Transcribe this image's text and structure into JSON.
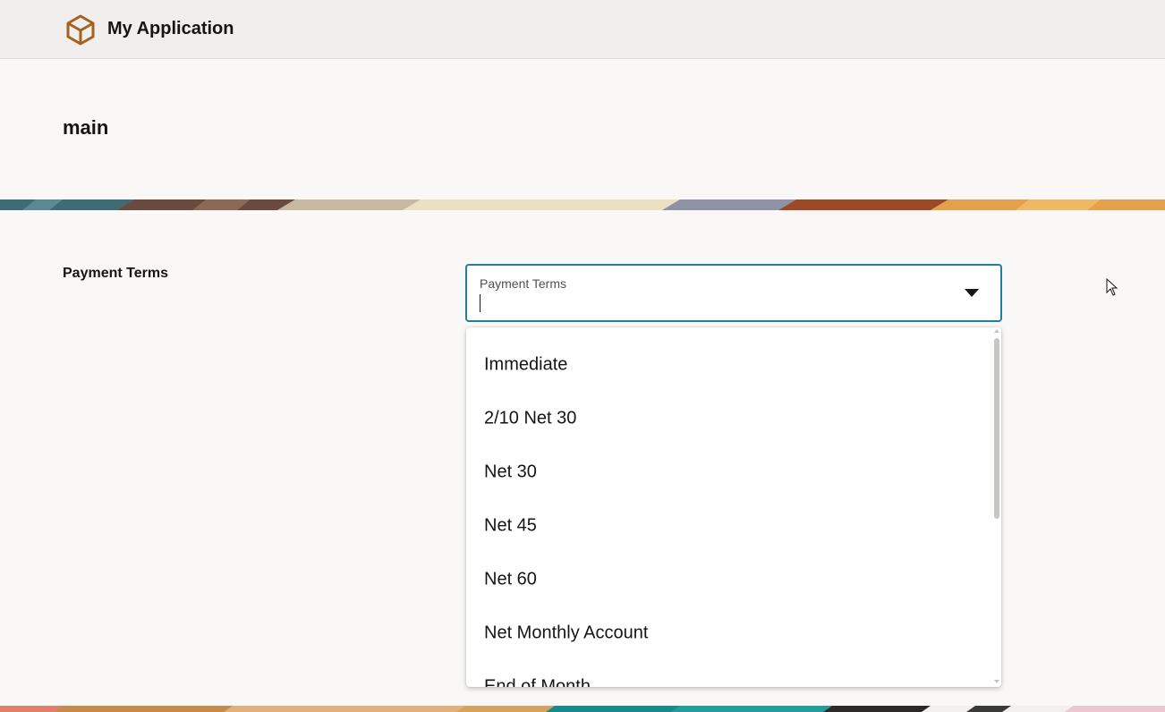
{
  "header": {
    "app_title": "My Application",
    "logo_icon": "package-box-icon",
    "logo_color": "#a6611e"
  },
  "page": {
    "title": "main"
  },
  "form": {
    "field_label": "Payment Terms",
    "combobox": {
      "floating_label": "Payment Terms",
      "value": "",
      "focus_color": "#227e9e",
      "dropdown_icon": "caret-down-icon"
    }
  },
  "dropdown": {
    "options": [
      "Immediate",
      "2/10 Net 30",
      "Net 30",
      "Net 45",
      "Net 60",
      "Net Monthly Account",
      "End of Month"
    ]
  }
}
